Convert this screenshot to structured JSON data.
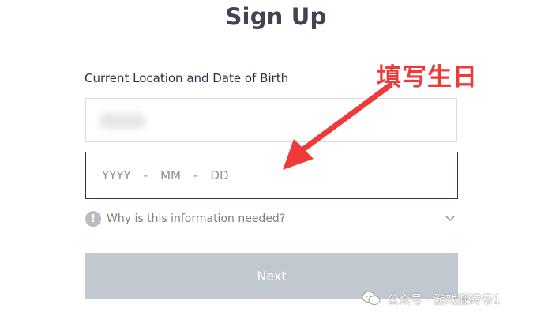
{
  "form": {
    "title": "Sign Up",
    "field_label": "Current Location and Date of Birth",
    "location_value": "",
    "dob": {
      "year_placeholder": "YYYY",
      "month_placeholder": "MM",
      "day_placeholder": "DD",
      "separator": "-"
    },
    "info_text": "Why is this information needed?",
    "next_label": "Next"
  },
  "annotation": {
    "text": "填写生日",
    "color": "#f03a3a"
  },
  "watermark": {
    "text": "公众号 · 游戏搬砖帝1"
  },
  "icons": {
    "info": "info-icon",
    "expand": "chevron-down-icon",
    "watermark": "wechat-icon"
  },
  "colors": {
    "title": "#3f4352",
    "focused_border": "#30344a",
    "button_disabled": "#c2c8d0"
  }
}
